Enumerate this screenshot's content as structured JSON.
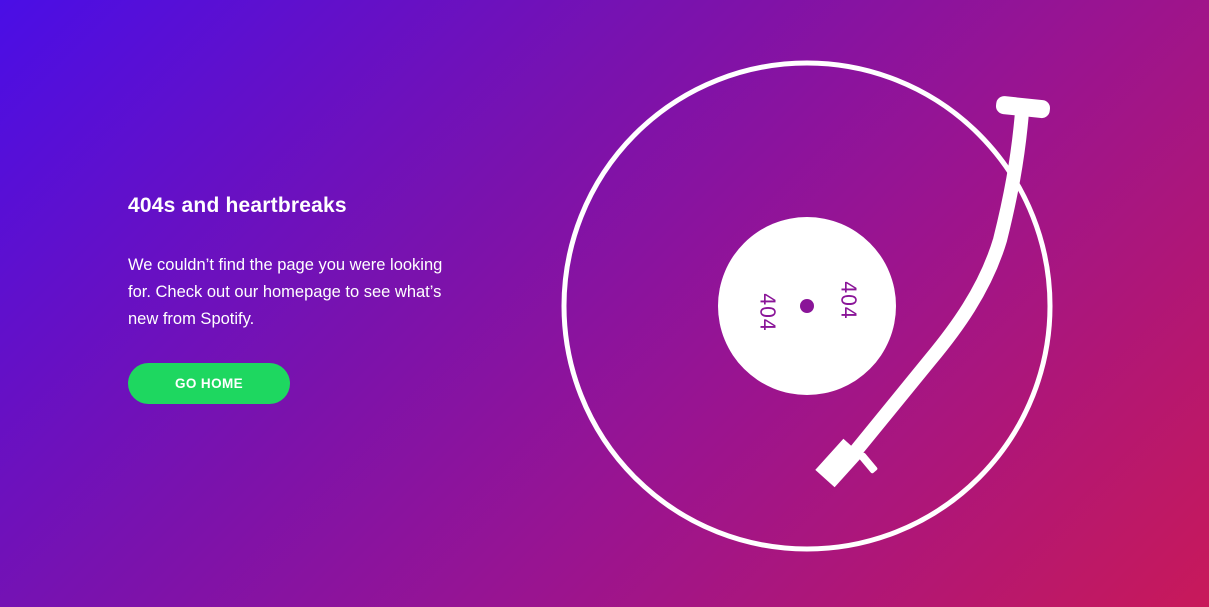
{
  "hero": {
    "title": "404s and heartbreaks",
    "description": "We couldn’t find the page you were looking for. Check out our homepage to see what’s new from Spotify.",
    "button_label": "GO HOME"
  },
  "record": {
    "label_text_left": "404",
    "label_text_right": "404"
  },
  "colors": {
    "button": "#1ed760",
    "gradient_start": "#4a0ee6",
    "gradient_end": "#c8195a",
    "label_ink": "#8a1598"
  }
}
